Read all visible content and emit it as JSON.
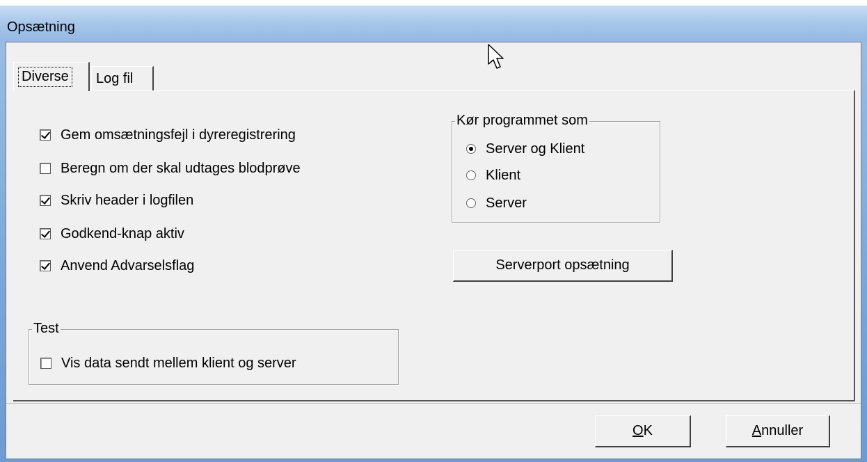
{
  "window": {
    "title": "Opsætning"
  },
  "tabs": [
    {
      "label": "Diverse",
      "active": true
    },
    {
      "label": "Log fil",
      "active": false
    }
  ],
  "options": [
    {
      "label": "Gem omsætningsfejl i dyreregistrering",
      "checked": true
    },
    {
      "label": "Beregn om der skal udtages blodprøve",
      "checked": false
    },
    {
      "label": "Skriv header i logfilen",
      "checked": true
    },
    {
      "label": "Godkend-knap aktiv",
      "checked": true
    },
    {
      "label": "Anvend Advarselsflag",
      "checked": true
    }
  ],
  "test_group": {
    "legend": "Test",
    "option": {
      "label": "Vis data sendt mellem klient og server",
      "checked": false
    }
  },
  "run_mode_group": {
    "legend": "Kør programmet som",
    "options": [
      {
        "label": "Server og Klient",
        "selected": true
      },
      {
        "label": "Klient",
        "selected": false
      },
      {
        "label": "Server",
        "selected": false
      }
    ]
  },
  "serverport_button": {
    "label": "Serverport opsætning"
  },
  "ok_button": {
    "mnemonic": "O",
    "rest": "K"
  },
  "cancel_button": {
    "mnemonic": "A",
    "rest": "nnuller"
  }
}
